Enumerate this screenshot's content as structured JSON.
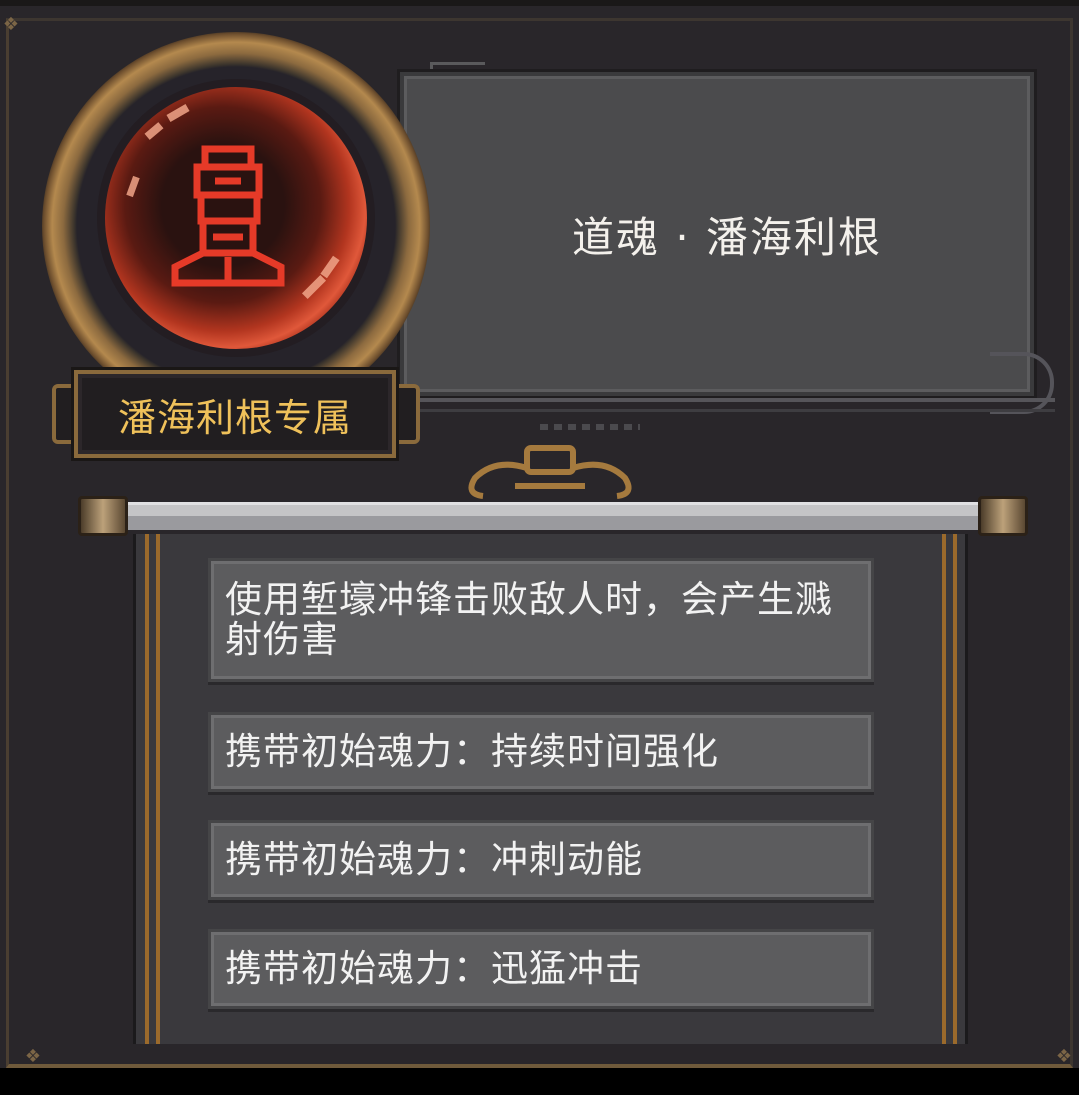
{
  "item": {
    "title": "道魂 · 潘海利根",
    "badge": "潘海利根专属"
  },
  "effects": [
    "使用堑壕冲锋击败敌人时，会产生溅射伤害",
    "携带初始魂力：持续时间强化",
    "携带初始魂力：冲刺动能",
    "携带初始魂力：迅猛冲击"
  ],
  "colors": {
    "badge_text": "#efc15a",
    "emblem": "#e63a28",
    "panel": "#29262a"
  }
}
